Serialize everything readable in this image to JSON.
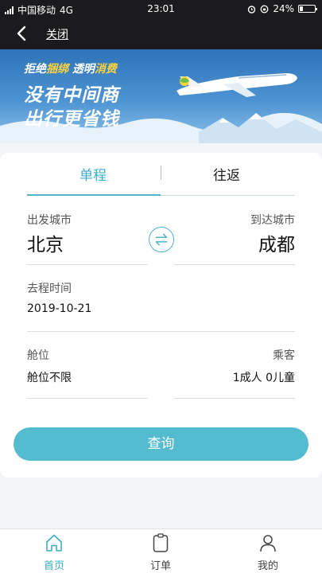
{
  "status_bar": {
    "carrier": "中国移动",
    "network": "4G",
    "time": "23:01",
    "battery": "24%",
    "battery_level": 0.24
  },
  "nav": {
    "back_icon": "chevron-left-icon",
    "close_label": "关闭"
  },
  "banner": {
    "tag_part1": "拒绝",
    "tag_part2": "捆绑",
    "tag_part3": "透明",
    "tag_part4": "消费",
    "line1": "没有中间商",
    "line2": "出行更省钱"
  },
  "trip_tabs": {
    "single": "单程",
    "round": "往返",
    "active": "single"
  },
  "form": {
    "from_label": "出发城市",
    "from_value": "北京",
    "to_label": "到达城市",
    "to_value": "成都",
    "swap_icon": "swap-arrows-icon",
    "date_label": "去程时间",
    "date_value": "2019-10-21",
    "cabin_label": "舱位",
    "cabin_value": "舱位不限",
    "passenger_label": "乘客",
    "passenger_value": "1成人 0儿童"
  },
  "search_button": "查询",
  "tabbar": {
    "items": [
      {
        "label": "首页",
        "icon": "home-icon",
        "active": true
      },
      {
        "label": "订单",
        "icon": "order-icon",
        "active": false
      },
      {
        "label": "我的",
        "icon": "profile-icon",
        "active": false
      }
    ]
  },
  "colors": {
    "accent": "#4fb6c8",
    "button": "#55bcd0",
    "header_bg": "#1b1b1d"
  }
}
